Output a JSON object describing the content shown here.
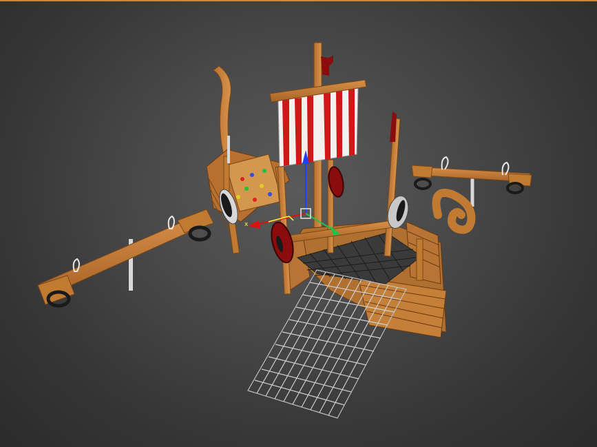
{
  "viewport": {
    "active_border_color": "#c98a2a",
    "background_color": "#4a4a4a"
  },
  "gizmo": {
    "x_axis_label": "x",
    "x_color": "#e01010",
    "y_color": "#1fc24a",
    "z_color": "#2040ff",
    "plane_xy_color": "#ffff30"
  },
  "scene": {
    "object": "viking-ship-playground",
    "wood_color": "#c07a32",
    "wood_dark_color": "#8a5220",
    "sail_red": "#d01818",
    "sail_white": "#f4f0ee",
    "shield_red": "#8a0c0c",
    "net_color": "#cfcfcf",
    "tire_color": "#1a1a1a"
  }
}
